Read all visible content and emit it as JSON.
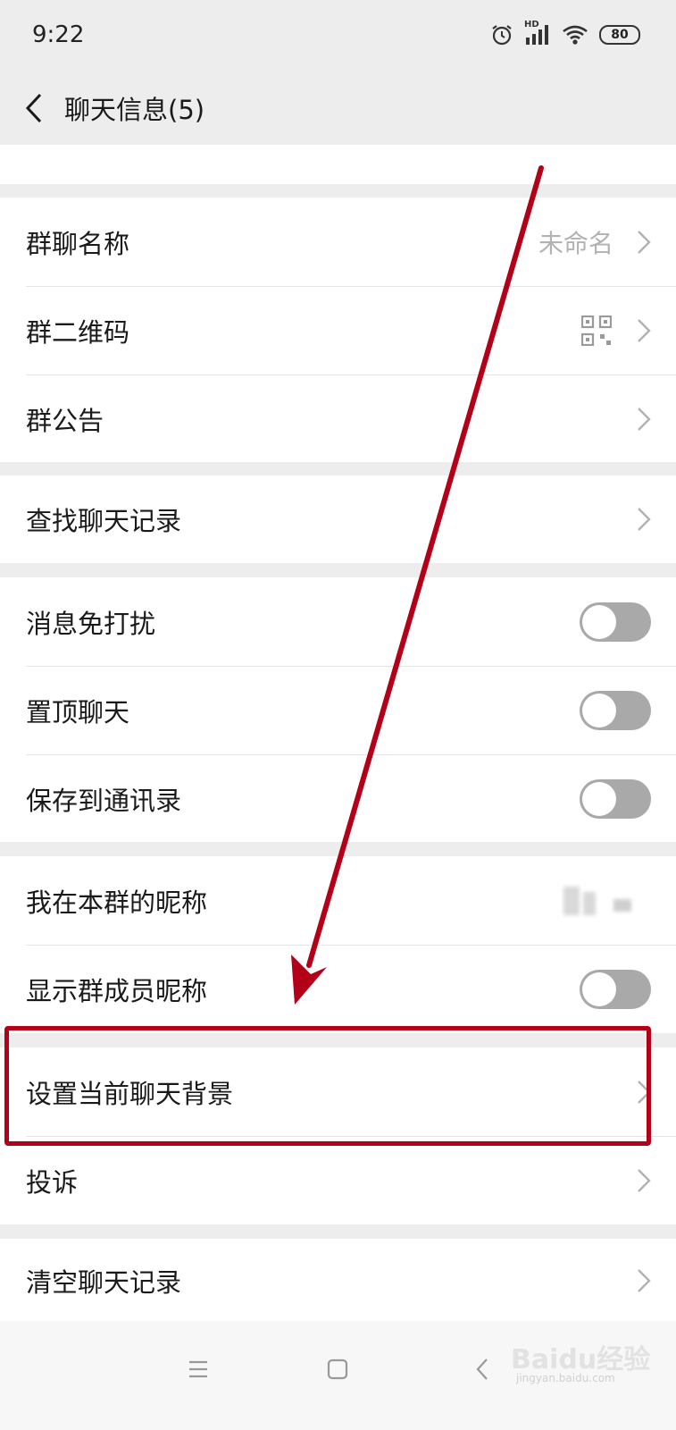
{
  "status_bar": {
    "time": "9:22",
    "network_label": "HD",
    "battery": "80",
    "icons": [
      "alarm-icon",
      "signal-icon",
      "wifi-icon",
      "battery-icon"
    ]
  },
  "header": {
    "title": "聊天信息(5)"
  },
  "group_section": {
    "name_label": "群聊名称",
    "name_value": "未命名",
    "qrcode_label": "群二维码",
    "announcement_label": "群公告"
  },
  "search_section": {
    "label": "查找聊天记录"
  },
  "toggle_section": {
    "mute_label": "消息免打扰",
    "mute_on": false,
    "pin_label": "置顶聊天",
    "pin_on": false,
    "save_label": "保存到通讯录",
    "save_on": false
  },
  "nickname_section": {
    "my_nickname_label": "我在本群的昵称",
    "show_nicknames_label": "显示群成员昵称",
    "show_nicknames_on": false
  },
  "background_section": {
    "background_label": "设置当前聊天背景",
    "complain_label": "投诉"
  },
  "clear_section": {
    "label": "清空聊天记录"
  },
  "annotation": {
    "color": "#b30018"
  },
  "watermark": {
    "text": "Baidu经验",
    "sub": "jingyan.baidu.com"
  },
  "system_nav": {
    "icons": [
      "menu-icon",
      "home-icon",
      "back-icon"
    ]
  }
}
